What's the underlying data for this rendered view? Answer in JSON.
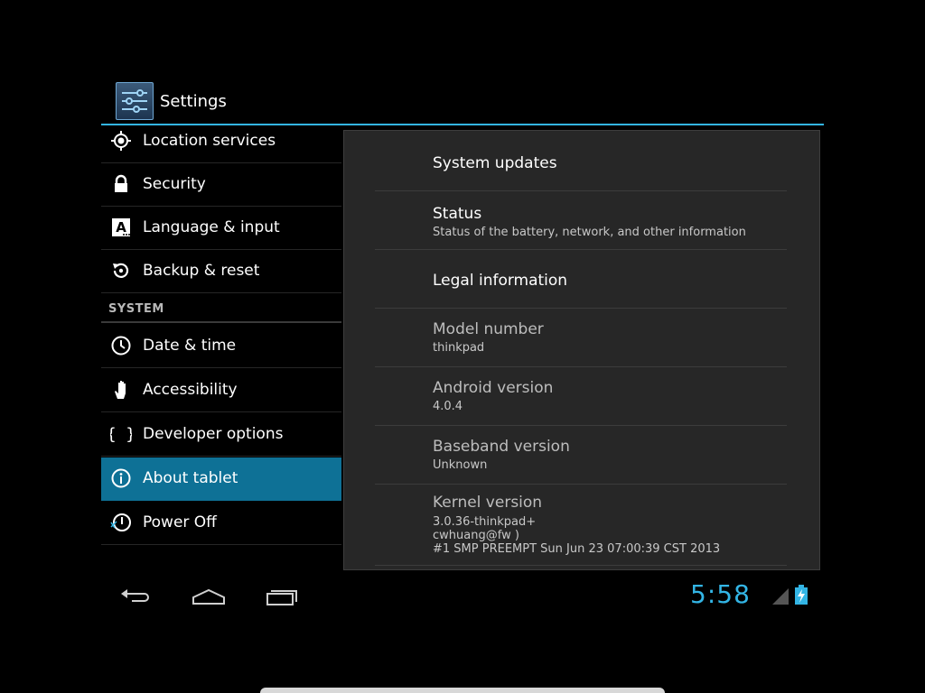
{
  "app": {
    "title": "Settings",
    "icon": "settings-sliders-icon"
  },
  "accent_color": "#33b5e5",
  "selected_color": "#0e7196",
  "sidebar": {
    "items": [
      {
        "label": "Location services",
        "icon": "location-icon"
      },
      {
        "label": "Security",
        "icon": "lock-icon"
      },
      {
        "label": "Language & input",
        "icon": "language-icon"
      },
      {
        "label": "Backup & reset",
        "icon": "backup-icon"
      },
      {
        "label": "Date & time",
        "icon": "clock-icon"
      },
      {
        "label": "Accessibility",
        "icon": "hand-icon"
      },
      {
        "label": "Developer options",
        "icon": "braces-icon"
      },
      {
        "label": "About tablet",
        "icon": "info-icon",
        "selected": true
      },
      {
        "label": "Power Off",
        "icon": "power-icon"
      }
    ],
    "section_header": "SYSTEM"
  },
  "about": {
    "items": [
      {
        "title": "System updates",
        "summary": ""
      },
      {
        "title": "Status",
        "summary": "Status of the battery, network, and other information"
      },
      {
        "title": "Legal information",
        "summary": ""
      },
      {
        "title": "Model number",
        "summary": "thinkpad"
      },
      {
        "title": "Android version",
        "summary": "4.0.4"
      },
      {
        "title": "Baseband version",
        "summary": "Unknown"
      },
      {
        "title": "Kernel version",
        "summary": "3.0.36-thinkpad+\ncwhuang@fw )\n#1 SMP PREEMPT Sun Jun 23 07:00:39 CST 2013"
      }
    ]
  },
  "navbar": {
    "back_icon": "back-icon",
    "home_icon": "home-icon",
    "recents_icon": "recent-apps-icon",
    "clock": "5:58",
    "signal_icon": "no-signal-icon",
    "battery_icon": "battery-charging-icon"
  }
}
